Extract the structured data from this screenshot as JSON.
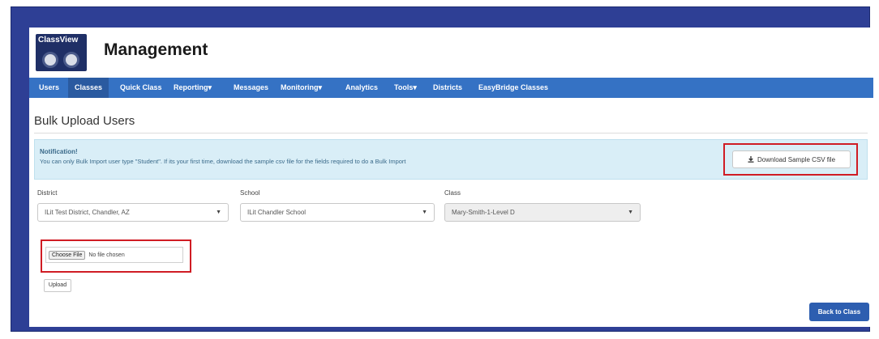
{
  "app": {
    "logo_text": "ClassView",
    "title": "Management"
  },
  "nav": {
    "items": [
      {
        "label": "Users"
      },
      {
        "label": "Classes"
      },
      {
        "label": "Quick Class"
      },
      {
        "label": "Reporting"
      },
      {
        "label": "Messages"
      },
      {
        "label": "Monitoring"
      },
      {
        "label": "Analytics"
      },
      {
        "label": "Tools"
      },
      {
        "label": "Districts"
      },
      {
        "label": "EasyBridge Classes"
      }
    ],
    "active": "Classes",
    "dropdown_caret": "▾"
  },
  "page": {
    "title": "Bulk Upload Users"
  },
  "notification": {
    "title": "Notification!",
    "body": "You can only Bulk Import user type \"Student\". If its your first time, download the sample csv file for the fields required to do a Bulk Import"
  },
  "download": {
    "label": "Download Sample CSV file",
    "icon": "download-icon"
  },
  "form": {
    "district": {
      "label": "District",
      "value": "ILit Test District, Chandler, AZ"
    },
    "school": {
      "label": "School",
      "value": "ILit Chandler School"
    },
    "class": {
      "label": "Class",
      "value": "Mary-Smith-1-Level D",
      "disabled": true
    },
    "select_caret": "▼"
  },
  "file": {
    "choose_label": "Choose File",
    "status": "No file chosen"
  },
  "actions": {
    "upload_label": "Upload",
    "back_label": "Back to Class"
  },
  "colors": {
    "frame": "#2e3f95",
    "nav": "#3572c4",
    "highlight": "#d01c24",
    "primary_button": "#2d5eb0",
    "alert_bg": "#d9eef7"
  }
}
